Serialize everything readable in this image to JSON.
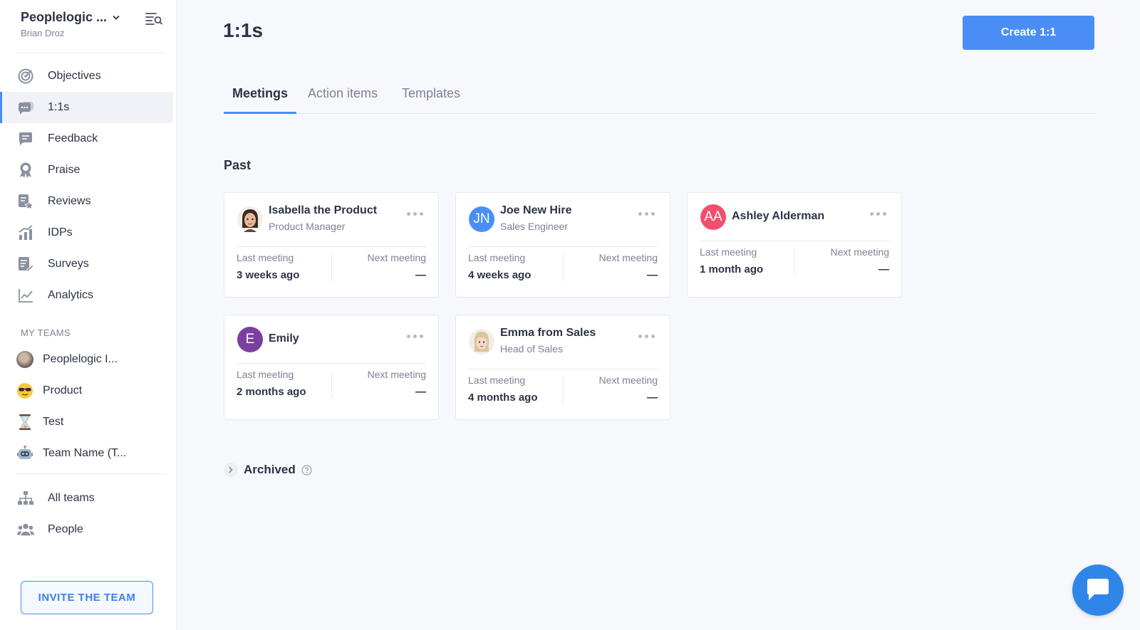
{
  "org": {
    "name": "Peoplelogic ...",
    "user": "Brian Droz"
  },
  "nav": [
    {
      "label": "Objectives",
      "icon": "target-icon"
    },
    {
      "label": "1:1s",
      "icon": "chat-bubbles-icon",
      "active": true
    },
    {
      "label": "Feedback",
      "icon": "message-icon"
    },
    {
      "label": "Praise",
      "icon": "award-icon"
    },
    {
      "label": "Reviews",
      "icon": "review-star-icon"
    },
    {
      "label": "IDPs",
      "icon": "growth-bars-icon"
    },
    {
      "label": "Surveys",
      "icon": "survey-icon"
    },
    {
      "label": "Analytics",
      "icon": "line-chart-icon"
    }
  ],
  "teams_header": "MY TEAMS",
  "teams": [
    {
      "label": "Peoplelogic I...",
      "avatar": "team-photo-avatar"
    },
    {
      "label": "Product",
      "avatar": "sunglasses-emoji-avatar"
    },
    {
      "label": "Test",
      "avatar": "hourglass-emoji-avatar"
    },
    {
      "label": "Team Name (T...",
      "avatar": "robot-emoji-avatar"
    }
  ],
  "bottom_nav": [
    {
      "label": "All teams",
      "icon": "org-chart-icon"
    },
    {
      "label": "People",
      "icon": "people-icon"
    }
  ],
  "invite_label": "INVITE THE TEAM",
  "page_title": "1:1s",
  "create_label": "Create 1:1",
  "tabs": [
    {
      "label": "Meetings",
      "active": true
    },
    {
      "label": "Action items"
    },
    {
      "label": "Templates"
    }
  ],
  "section_past": "Past",
  "meetings": [
    {
      "name": "Isabella the Product",
      "role": "Product Manager",
      "avatar_type": "memoji-woman",
      "initials": "",
      "avatar_color": "#e8d4c4",
      "last_label": "Last meeting",
      "last_value": "3 weeks ago",
      "next_label": "Next meeting",
      "next_value": "—"
    },
    {
      "name": "Joe New Hire",
      "role": "Sales Engineer",
      "avatar_type": "initials",
      "initials": "JN",
      "avatar_color": "#4a8ef5",
      "last_label": "Last meeting",
      "last_value": "4 weeks ago",
      "next_label": "Next meeting",
      "next_value": "—"
    },
    {
      "name": "Ashley Alderman",
      "role": "",
      "avatar_type": "initials",
      "initials": "AA",
      "avatar_color": "#f0506e",
      "last_label": "Last meeting",
      "last_value": "1 month ago",
      "next_label": "Next meeting",
      "next_value": "—"
    },
    {
      "name": "Emily",
      "role": "",
      "avatar_type": "initials",
      "initials": "E",
      "avatar_color": "#7b3fa0",
      "last_label": "Last meeting",
      "last_value": "2 months ago",
      "next_label": "Next meeting",
      "next_value": "—"
    },
    {
      "name": "Emma from Sales",
      "role": "Head of Sales",
      "avatar_type": "memoji-blonde",
      "initials": "",
      "avatar_color": "#e6e2dc",
      "last_label": "Last meeting",
      "last_value": "4 months ago",
      "next_label": "Next meeting",
      "next_value": "—"
    }
  ],
  "archived_label": "Archived",
  "colors": {
    "accent": "#4a8ef5",
    "chat": "#2f86e8"
  }
}
